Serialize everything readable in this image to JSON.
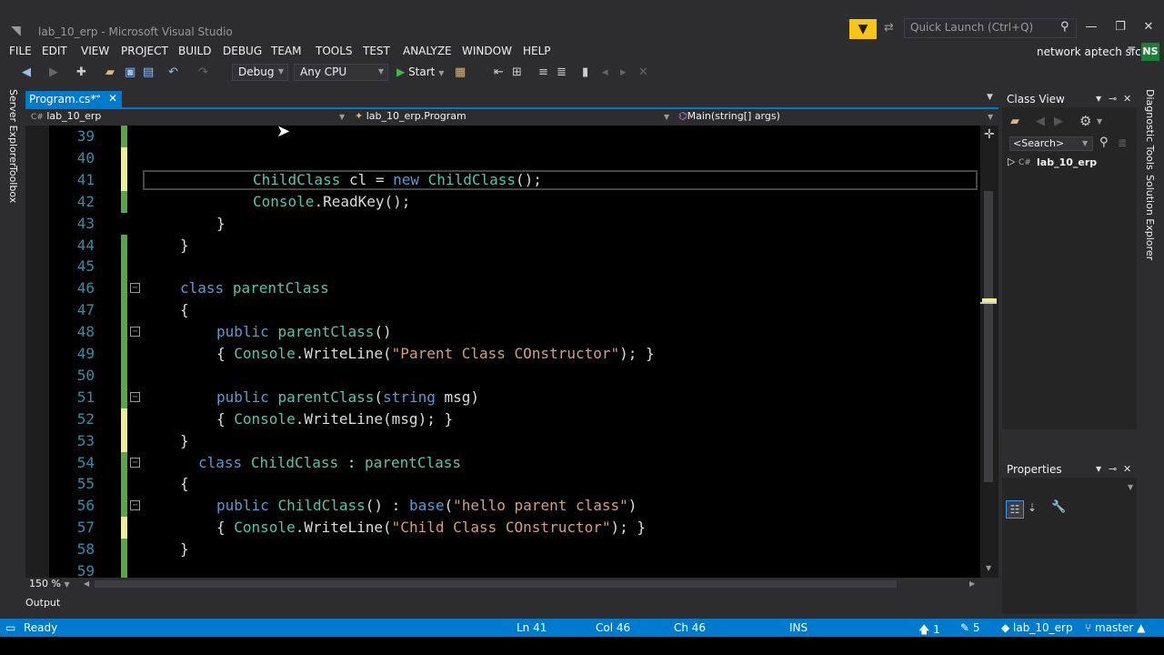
{
  "window": {
    "title": "lab_10_erp - Microsoft Visual Studio",
    "quick_launch_placeholder": "Quick Launch (Ctrl+Q)",
    "account": "network aptech sfc",
    "avatar_initials": "NS"
  },
  "menu": [
    "FILE",
    "EDIT",
    "VIEW",
    "PROJECT",
    "BUILD",
    "DEBUG",
    "TEAM",
    "TOOLS",
    "TEST",
    "ANALYZE",
    "WINDOW",
    "HELP"
  ],
  "toolbar": {
    "configuration": "Debug",
    "platform": "Any CPU",
    "start_label": "Start"
  },
  "tab": {
    "label": "Program.cs*"
  },
  "navbar": {
    "project": "lab_10_erp",
    "class": "lab_10_erp.Program",
    "member": "Main(string[] args)"
  },
  "side_labels": {
    "left1": "Server Explorer",
    "left2": "Toolbox",
    "right1": "Diagnostic Tools",
    "right2": "Solution Explorer"
  },
  "class_view": {
    "title": "Class View",
    "search_placeholder": "<Search>",
    "node": "lab_10_erp"
  },
  "properties": {
    "title": "Properties"
  },
  "editor": {
    "zoom": "150 %",
    "lines": [
      {
        "n": "39",
        "change": "green",
        "text": ""
      },
      {
        "n": "40",
        "change": "yellow",
        "text": ""
      },
      {
        "n": "41",
        "change": "yellow",
        "text": "ChildClass cl = new ChildClass();"
      },
      {
        "n": "42",
        "change": "green",
        "text": "Console.ReadKey();"
      },
      {
        "n": "43",
        "change": "none",
        "text": "}"
      },
      {
        "n": "44",
        "change": "green",
        "text": "}"
      },
      {
        "n": "45",
        "change": "green",
        "text": ""
      },
      {
        "n": "46",
        "change": "green",
        "text": "class parentClass"
      },
      {
        "n": "47",
        "change": "green",
        "text": "{"
      },
      {
        "n": "48",
        "change": "green",
        "text": "public parentClass()"
      },
      {
        "n": "49",
        "change": "green",
        "text": "{ Console.WriteLine(\"Parent Class COnstructor\"); }"
      },
      {
        "n": "50",
        "change": "green",
        "text": ""
      },
      {
        "n": "51",
        "change": "green",
        "text": "public parentClass(string msg)"
      },
      {
        "n": "52",
        "change": "yellow",
        "text": "{ Console.WriteLine(msg); }"
      },
      {
        "n": "53",
        "change": "yellow",
        "text": "}"
      },
      {
        "n": "54",
        "change": "green",
        "text": "class ChildClass : parentClass"
      },
      {
        "n": "55",
        "change": "green",
        "text": "{"
      },
      {
        "n": "56",
        "change": "green",
        "text": "public ChildClass() : base(\"hello parent class\")"
      },
      {
        "n": "57",
        "change": "yellow",
        "text": "{ Console.WriteLine(\"Child Class COnstructor\"); }"
      },
      {
        "n": "58",
        "change": "green",
        "text": "}"
      },
      {
        "n": "59",
        "change": "green",
        "text": ""
      }
    ]
  },
  "output": {
    "label": "Output"
  },
  "status": {
    "state": "Ready",
    "ln": "Ln 41",
    "col": "Col 46",
    "ch": "Ch 46",
    "mode": "INS",
    "up_count": "1",
    "edit_count": "5",
    "repo": "lab_10_erp",
    "branch": "master"
  },
  "colors": {
    "accent": "#007acc",
    "keyword": "#569cd6",
    "type": "#4ec9b0",
    "string": "#d69d85",
    "line_number": "#2b91af",
    "change_saved": "#57a64a",
    "change_unsaved": "#efef91"
  }
}
